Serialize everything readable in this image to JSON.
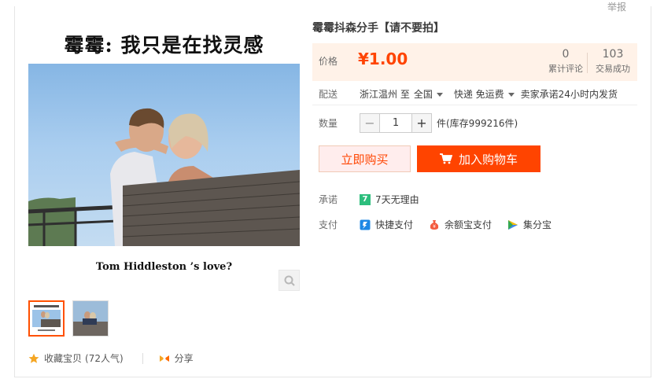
{
  "report_label": "举报",
  "gallery": {
    "poster_title": "霉霉: 我只是在找灵感",
    "poster_caption": "Tom Hiddleston ’s  love?"
  },
  "favorite": {
    "label": "收藏宝贝",
    "popularity": "(72人气)",
    "share_label": "分享"
  },
  "product": {
    "title": "霉霉抖森分手【请不要拍】",
    "price_label": "价格",
    "price": "¥1.00",
    "reviews_count": "0",
    "reviews_label": "累计评论",
    "sales_count": "103",
    "sales_label": "交易成功"
  },
  "shipping": {
    "label": "配送",
    "origin": "浙江温州 至",
    "destination": "全国",
    "method": "快递 免运费",
    "promise": "卖家承诺24小时内发货"
  },
  "quantity": {
    "label": "数量",
    "minus": "−",
    "value": "1",
    "plus": "+",
    "stock": "件(库存999216件)"
  },
  "actions": {
    "buy_now": "立即购买",
    "add_to_cart": "加入购物车"
  },
  "guarantee": {
    "label": "承诺",
    "badge": "7",
    "text": "7天无理由"
  },
  "payment": {
    "label": "支付",
    "methods": [
      "快捷支付",
      "余额宝支付",
      "集分宝"
    ]
  },
  "colors": {
    "accent": "#ff4400",
    "price": "#f40",
    "price_bg": "#fff2e8"
  }
}
